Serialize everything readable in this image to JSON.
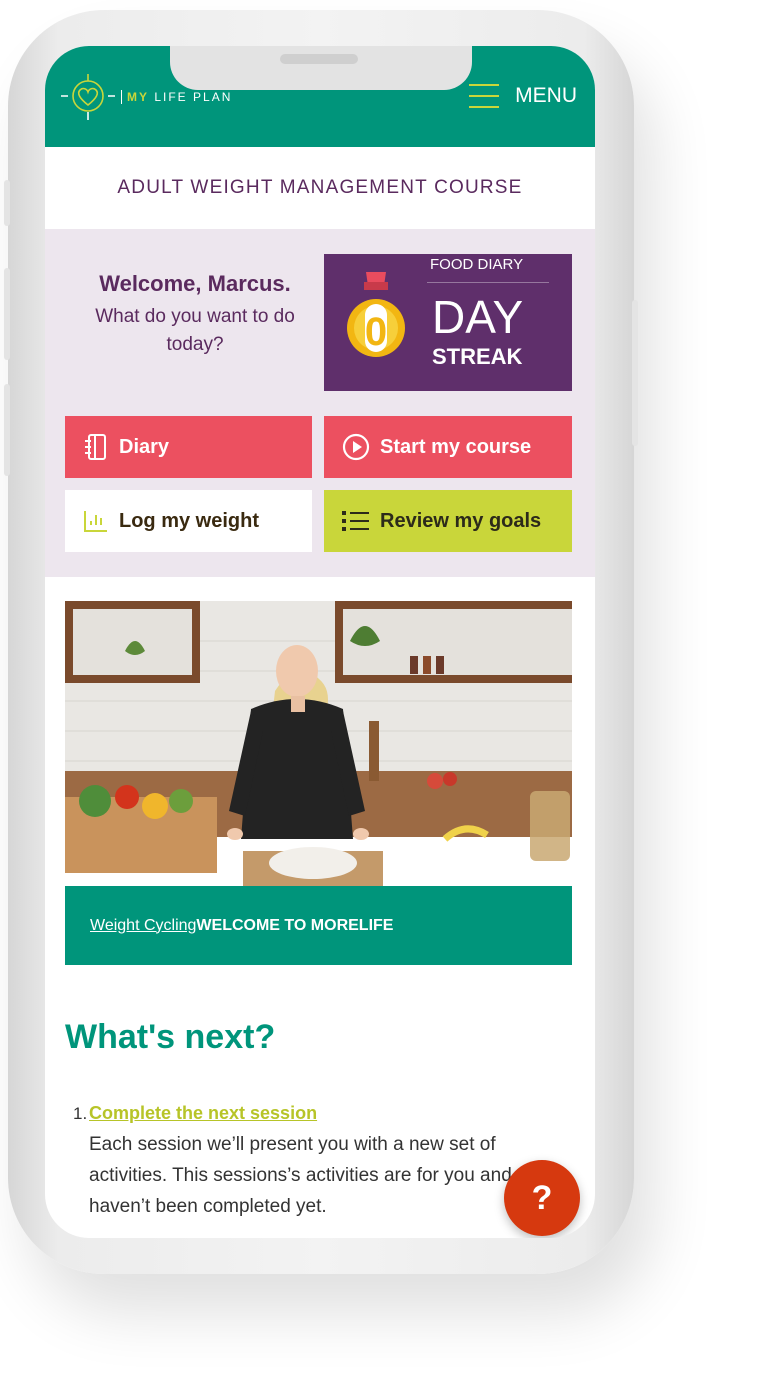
{
  "header": {
    "logo_prefix": "MY",
    "logo_suffix": " LIFE PLAN",
    "menu_label": "MENU"
  },
  "course_title": "ADULT WEIGHT MANAGEMENT COURSE",
  "welcome": {
    "greeting": "Welcome, Marcus.",
    "prompt": "What do you want to do today?"
  },
  "streak": {
    "label": "FOOD DIARY",
    "count": "0",
    "day": "DAY",
    "word": "STREAK"
  },
  "actions": {
    "diary": "Diary",
    "start_course": "Start my course",
    "log_weight": "Log my weight",
    "review_goals": "Review my goals"
  },
  "video": {
    "link_text": "Weight Cycling",
    "title": "WELCOME TO MORELIFE"
  },
  "whats_next": {
    "heading": "What's next?",
    "items": [
      {
        "number": "1.",
        "link": "Complete the next session",
        "description": "Each session we’ll present you with a new set of activities. This sessions’s activities are for you and haven’t been completed yet."
      }
    ]
  },
  "help_button": "?",
  "colors": {
    "brand_green": "#00957b",
    "accent_lime": "#c9d63a",
    "accent_red": "#ec5060",
    "brand_purple": "#5f2f6b",
    "panel_lilac": "#ede6ee",
    "help_orange": "#d6390f"
  }
}
